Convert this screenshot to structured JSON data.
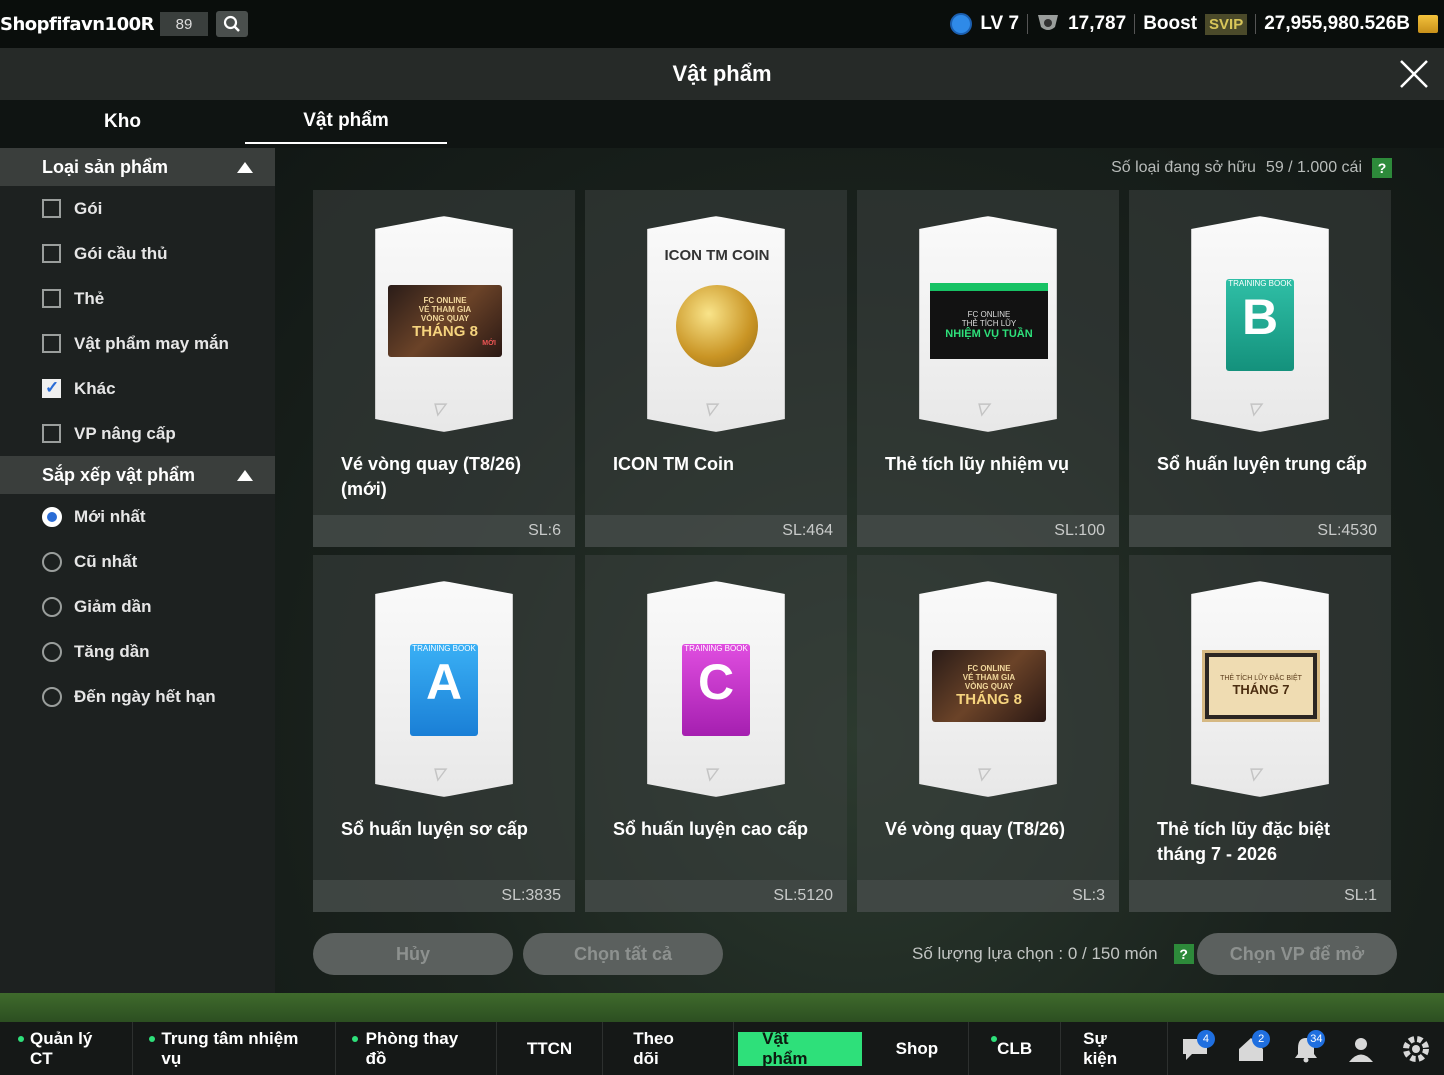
{
  "top": {
    "username": "Shopfifavn100R",
    "user_num": "89",
    "level": "LV 7",
    "points": "17,787",
    "boost": "Boost",
    "svip": "SVIP",
    "bp": "27,955,980.526B"
  },
  "title": "Vật phẩm",
  "tabs": [
    "Kho",
    "Vật phẩm"
  ],
  "filter": {
    "header": "Loại sản phẩm",
    "options": [
      {
        "label": "Gói",
        "checked": false
      },
      {
        "label": "Gói cầu thủ",
        "checked": false
      },
      {
        "label": "Thẻ",
        "checked": false
      },
      {
        "label": "Vật phẩm may mắn",
        "checked": false
      },
      {
        "label": "Khác",
        "checked": true
      },
      {
        "label": "VP nâng cấp",
        "checked": false
      }
    ]
  },
  "sort": {
    "header": "Sắp xếp vật phẩm",
    "options": [
      {
        "label": "Mới nhất",
        "selected": true
      },
      {
        "label": "Cũ nhất",
        "selected": false
      },
      {
        "label": "Giảm dần",
        "selected": false
      },
      {
        "label": "Tăng dần",
        "selected": false
      },
      {
        "label": "Đến ngày hết hạn",
        "selected": false
      }
    ]
  },
  "owned": {
    "label": "Số loại đang sở hữu",
    "value": "59 / 1.000 cái",
    "help": "?"
  },
  "items": [
    {
      "name": "Vé vòng quay (T8/26) (mới)",
      "qty": "SL:6",
      "art": {
        "brand": "FC ONLINE",
        "line1": "VÉ THAM GIA",
        "line2": "VÒNG QUAY",
        "big": "THÁNG 8",
        "tag": "MỚI"
      }
    },
    {
      "name": "ICON TM Coin",
      "qty": "SL:464",
      "art": {
        "label": "ICON TM COIN"
      }
    },
    {
      "name": "Thẻ tích lũy nhiệm vụ",
      "qty": "SL:100",
      "art": {
        "brand": "FC ONLINE",
        "line1": "THẺ TÍCH LŨY",
        "big": "NHIỆM VỤ TUẦN"
      }
    },
    {
      "name": "Sổ huấn luyện trung cấp",
      "qty": "SL:4530",
      "art": {
        "label": "TRAINING BOOK",
        "letter": "B"
      }
    },
    {
      "name": "Sổ huấn luyện sơ cấp",
      "qty": "SL:3835",
      "art": {
        "label": "TRAINING BOOK",
        "letter": "A"
      }
    },
    {
      "name": "Sổ huấn luyện cao cấp",
      "qty": "SL:5120",
      "art": {
        "label": "TRAINING BOOK",
        "letter": "C"
      }
    },
    {
      "name": "Vé vòng quay (T8/26)",
      "qty": "SL:3",
      "art": {
        "brand": "FC ONLINE",
        "line1": "VÉ THAM GIA",
        "line2": "VÒNG QUAY",
        "big": "THÁNG 8"
      }
    },
    {
      "name": "Thẻ tích lũy đặc biệt tháng 7 - 2026",
      "qty": "SL:1",
      "art": {
        "line1": "THẺ TÍCH LŨY ĐẶC BIỆT",
        "big": "THÁNG 7"
      }
    }
  ],
  "actions": {
    "cancel": "Hủy",
    "select_all": "Chọn tất cả",
    "selection_label": "Số lượng lựa chọn : 0 / 150 món",
    "help": "?",
    "open": "Chọn VP để mở"
  },
  "nav": [
    {
      "label": "Quản lý CT",
      "dot": true
    },
    {
      "label": "Trung tâm nhiệm vụ",
      "dot": true
    },
    {
      "label": "Phòng thay đồ",
      "dot": true
    },
    {
      "label": "TTCN",
      "dot": false
    },
    {
      "label": "Theo dõi",
      "dot": false
    },
    {
      "label": "Vật phẩm",
      "dot": false,
      "active": true
    },
    {
      "label": "Shop",
      "dot": false
    },
    {
      "label": "CLB",
      "dot": true
    },
    {
      "label": "Sự kiện",
      "dot": false
    }
  ],
  "nav_icons": [
    {
      "name": "chat-icon",
      "badge": "4"
    },
    {
      "name": "home-icon",
      "badge": "2"
    },
    {
      "name": "bell-icon",
      "badge": "34"
    },
    {
      "name": "profile-icon",
      "badge": ""
    },
    {
      "name": "settings-icon",
      "badge": ""
    }
  ],
  "colors": {
    "accent": "#2ee07a",
    "checkbox": "#2a6cd6",
    "help": "#2d8a3a"
  }
}
